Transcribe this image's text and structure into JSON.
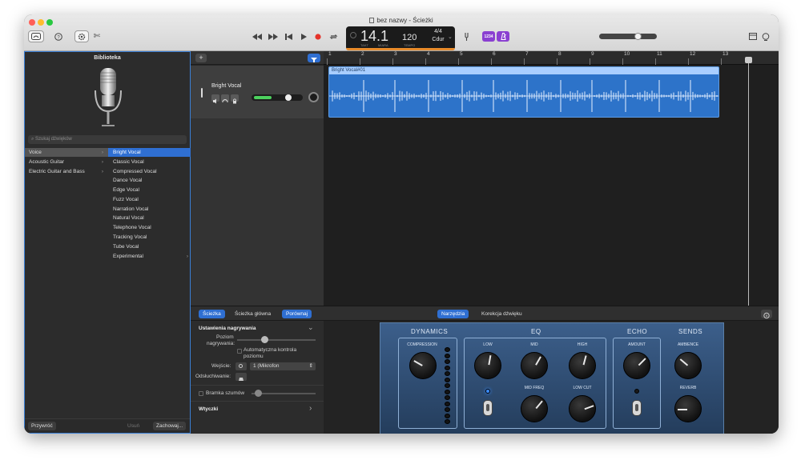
{
  "window": {
    "title": "bez nazwy - Ścieżki",
    "colors": {
      "accent": "#2f6fd2",
      "lcd_bar": "#e98b2a",
      "region": "#2d73c9",
      "purple": "#8a3fd1"
    }
  },
  "toolbar": {
    "scissors_glyph": "✄",
    "lcd": {
      "position": "14.1",
      "labels": {
        "bar": "TAKT",
        "beat": "MIARA",
        "tempo": "TEMPO"
      },
      "tempo": "120",
      "signature": "4/4",
      "key": "Cdur"
    },
    "count_in": "1234"
  },
  "library": {
    "title": "Biblioteka",
    "search_placeholder": "Szukaj dźwięków",
    "categories": [
      {
        "label": "Voice"
      },
      {
        "label": "Acoustic Guitar"
      },
      {
        "label": "Electric Guitar and Bass"
      }
    ],
    "presets": [
      "Bright Vocal",
      "Classic Vocal",
      "Compressed Vocal",
      "Dance Vocal",
      "Edge Vocal",
      "Fuzz Vocal",
      "Narration Vocal",
      "Natural Vocal",
      "Telephone Vocal",
      "Tracking Vocal",
      "Tube Vocal",
      "Experimental"
    ],
    "buttons": {
      "revert": "Przywróć",
      "delete": "Usuń",
      "save": "Zachowaj..."
    }
  },
  "tracks": {
    "add_glyph": "+",
    "track_name": "Bright Vocal",
    "region_name": "Bright Vocal#01",
    "ruler": [
      "1",
      "2",
      "3",
      "4",
      "5",
      "6",
      "7",
      "8",
      "9",
      "10",
      "11",
      "12",
      "13"
    ]
  },
  "editor": {
    "tabs_left": [
      "Ścieżka",
      "Ścieżka główna",
      "Porównaj"
    ],
    "tabs_right": [
      "Narzędzia",
      "Korekcja dźwięku"
    ],
    "settings": {
      "section": "Ustawienia nagrywania",
      "level_label_1": "Poziom",
      "level_label_2": "nagrywania:",
      "auto_level_1": "Automatyczna kontrola",
      "auto_level_2": "poziomu",
      "input_label": "Wejście:",
      "input_value": "1 (Mikrofon",
      "monitoring_label": "Odsłuchiwanie:",
      "noise_gate": "Bramka szumów",
      "plugins": "Wtyczki"
    },
    "plugin": {
      "dynamics": {
        "title": "DYNAMICS",
        "knob": "COMPRESSION",
        "value": 0.35
      },
      "eq": {
        "title": "EQ",
        "low": "LOW",
        "mid": "MID",
        "high": "HIGH",
        "mid_freq": "MID FREQ",
        "low_cut": "LOW CUT"
      },
      "echo": {
        "title": "ECHO",
        "amount": "AMOUNT"
      },
      "sends": {
        "title": "SENDS",
        "ambience": "AMBIENCE",
        "reverb": "REVERB"
      }
    }
  }
}
